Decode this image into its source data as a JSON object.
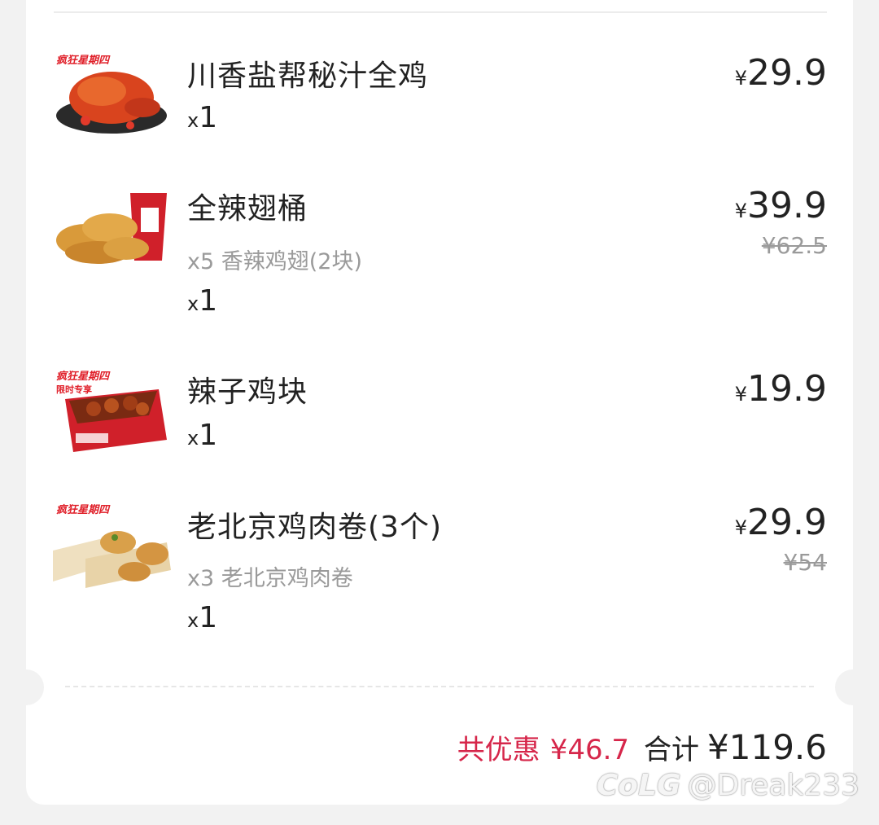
{
  "items": [
    {
      "name": "川香盐帮秘汁全鸡",
      "qty_prefix": "x",
      "qty": "1",
      "currency": "¥",
      "price": "29.9",
      "image": "roast-chicken-image",
      "promo": "疯狂星期四"
    },
    {
      "name": "全辣翅桶",
      "detail": "x5 香辣鸡翅(2块)",
      "qty_prefix": "x",
      "qty": "1",
      "currency": "¥",
      "price": "39.9",
      "original_price": "¥62.5",
      "image": "wing-bucket-image"
    },
    {
      "name": "辣子鸡块",
      "qty_prefix": "x",
      "qty": "1",
      "currency": "¥",
      "price": "19.9",
      "image": "chicken-nuggets-box-image",
      "promo": "疯狂星期四"
    },
    {
      "name": "老北京鸡肉卷(3个)",
      "detail": "x3 老北京鸡肉卷",
      "qty_prefix": "x",
      "qty": "1",
      "currency": "¥",
      "price": "29.9",
      "original_price": "¥54",
      "image": "chicken-wraps-image",
      "promo": "疯狂星期四"
    }
  ],
  "summary": {
    "discount_label": "共优惠",
    "discount_value": "¥46.7",
    "total_label": "合计",
    "total_value": "¥119.6"
  },
  "watermark": {
    "logo": "CoLG",
    "handle": "@Dreak233"
  },
  "colors": {
    "discount": "#d6264a",
    "text": "#222222",
    "muted": "#9a9a9a",
    "background": "#f2f2f2",
    "card": "#ffffff"
  }
}
